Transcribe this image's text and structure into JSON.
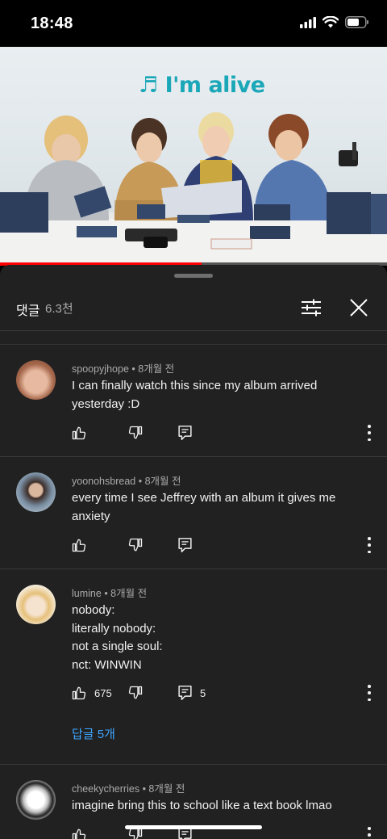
{
  "status": {
    "time": "18:48"
  },
  "video": {
    "title_overlay": "♬ I'm alive",
    "progress": 0.52,
    "colors": {
      "progress": "#ff0000",
      "title": "#1aa7b8"
    }
  },
  "panel": {
    "title": "댓글",
    "count": "6.3천",
    "icons": {
      "filter": "sliders-icon",
      "close": "close-icon"
    }
  },
  "comments": [
    {
      "author": "spoopyjhope",
      "time": "• 8개월 전",
      "lines": [
        "I can finally watch this since my album arrived yesterday :D"
      ],
      "likes": "",
      "reply_count": ""
    },
    {
      "author": "yoonohsbread",
      "time": "• 8개월 전",
      "lines": [
        "every time I see Jeffrey with an album it gives me anxiety"
      ],
      "likes": "",
      "reply_count": ""
    },
    {
      "author": "lumine",
      "time": "• 8개월 전",
      "lines": [
        "nobody:",
        "literally nobody:",
        "not a single soul:",
        "nct: WINWIN"
      ],
      "likes": "675",
      "reply_count": "5",
      "replies_link": "답글 5개"
    },
    {
      "author": "cheekycherries",
      "time": "• 8개월 전",
      "lines": [
        "imagine bring this to school like a text book lmao"
      ],
      "likes": "",
      "reply_count": ""
    }
  ],
  "accent_link_color": "#3ea6ff"
}
